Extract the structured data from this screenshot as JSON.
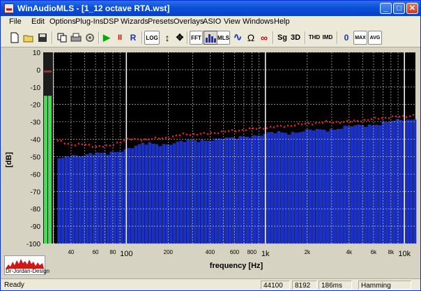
{
  "window": {
    "title": "WinAudioMLS - [1_12 octave RTA.wst]",
    "minimize_glyph": "_",
    "maximize_glyph": "□",
    "close_glyph": "✕"
  },
  "menu": [
    "File",
    "Edit",
    "Options",
    "Plug-Ins",
    "DSP",
    "Wizards",
    "Presets",
    "Overlays",
    "ASIO",
    "View",
    "Windows",
    "Help"
  ],
  "toolbar": {
    "buttons": [
      {
        "name": "new-file-icon",
        "label": ""
      },
      {
        "name": "open-folder-icon",
        "label": ""
      },
      {
        "name": "save-disk-icon",
        "label": ""
      },
      {
        "name": "copy-icon",
        "label": ""
      },
      {
        "name": "print-icon",
        "label": ""
      },
      {
        "name": "plugin-icon",
        "label": ""
      },
      {
        "name": "play-icon",
        "label": "▶"
      },
      {
        "name": "pause-icon",
        "label": "II"
      },
      {
        "name": "record-button",
        "label": "R"
      },
      {
        "name": "log-scale-button",
        "label": "LOG"
      },
      {
        "name": "vertical-zoom-icon",
        "label": "↕"
      },
      {
        "name": "pan-cross-icon",
        "label": "✥"
      },
      {
        "name": "fft-button",
        "label": "FFT"
      },
      {
        "name": "bar-graph-icon",
        "label": ""
      },
      {
        "name": "mls-button",
        "label": "MLS"
      },
      {
        "name": "waveform-icon",
        "label": "∿"
      },
      {
        "name": "impedance-omega-icon",
        "label": "Ω"
      },
      {
        "name": "loop-signal-icon",
        "label": "∞"
      },
      {
        "name": "sg-button",
        "label": "Sg"
      },
      {
        "name": "3d-button",
        "label": "3D"
      },
      {
        "name": "thd-button",
        "label": "THD"
      },
      {
        "name": "imd-button",
        "label": "IMD"
      },
      {
        "name": "zero-button",
        "label": "0"
      },
      {
        "name": "max-button",
        "label": "MAX"
      },
      {
        "name": "avg-button",
        "label": "AVG"
      }
    ]
  },
  "chart_data": {
    "type": "bar",
    "xlabel": "frequency [Hz]",
    "ylabel": "[dB]",
    "x_scale": "log",
    "xlim": [
      30,
      12000
    ],
    "ylim": [
      -100,
      10
    ],
    "y_ticks": [
      10,
      0,
      -10,
      -20,
      -30,
      -40,
      -50,
      -60,
      -70,
      -80,
      -90,
      -100
    ],
    "x_ticks": [
      {
        "value": 40,
        "label": "40",
        "major": false
      },
      {
        "value": 60,
        "label": "60",
        "major": false
      },
      {
        "value": 80,
        "label": "80",
        "major": false
      },
      {
        "value": 100,
        "label": "100",
        "major": true
      },
      {
        "value": 200,
        "label": "200",
        "major": false
      },
      {
        "value": 400,
        "label": "400",
        "major": false
      },
      {
        "value": 600,
        "label": "600",
        "major": false
      },
      {
        "value": 800,
        "label": "800",
        "major": false
      },
      {
        "value": 1000,
        "label": "1k",
        "major": true
      },
      {
        "value": 2000,
        "label": "2k",
        "major": false
      },
      {
        "value": 4000,
        "label": "4k",
        "major": false
      },
      {
        "value": 6000,
        "label": "6k",
        "major": false
      },
      {
        "value": 8000,
        "label": "8k",
        "major": false
      },
      {
        "value": 10000,
        "label": "10k",
        "major": true
      }
    ],
    "grid": true,
    "bar_anchors": [
      [
        33,
        -52
      ],
      [
        38,
        -50
      ],
      [
        45,
        -49
      ],
      [
        55,
        -48
      ],
      [
        70,
        -49
      ],
      [
        85,
        -47
      ],
      [
        100,
        -45
      ],
      [
        130,
        -43
      ],
      [
        170,
        -43
      ],
      [
        220,
        -42
      ],
      [
        300,
        -41
      ],
      [
        400,
        -40
      ],
      [
        550,
        -40
      ],
      [
        700,
        -38
      ],
      [
        900,
        -38
      ],
      [
        1200,
        -36
      ],
      [
        1600,
        -36
      ],
      [
        2200,
        -35
      ],
      [
        3000,
        -34
      ],
      [
        4000,
        -33
      ],
      [
        5000,
        -32
      ],
      [
        6500,
        -31
      ],
      [
        8000,
        -30
      ],
      [
        10000,
        -29
      ],
      [
        11500,
        -28
      ]
    ],
    "peak_anchors": [
      [
        33,
        -41
      ],
      [
        40,
        -43
      ],
      [
        50,
        -43
      ],
      [
        60,
        -44
      ],
      [
        75,
        -44
      ],
      [
        85,
        -42
      ],
      [
        100,
        -40
      ],
      [
        140,
        -40
      ],
      [
        200,
        -39
      ],
      [
        260,
        -37
      ],
      [
        350,
        -37
      ],
      [
        450,
        -36
      ],
      [
        600,
        -35
      ],
      [
        800,
        -34
      ],
      [
        1100,
        -33
      ],
      [
        1500,
        -32
      ],
      [
        2000,
        -31
      ],
      [
        2800,
        -30
      ],
      [
        3800,
        -30
      ],
      [
        5000,
        -29
      ],
      [
        6500,
        -28
      ],
      [
        8000,
        -27
      ],
      [
        10000,
        -27
      ],
      [
        11500,
        -26
      ]
    ],
    "peak_color": "#dd2222",
    "bar_color": "#1a2fc4",
    "plot_background": "#000000",
    "level_meter": {
      "left_db": -100,
      "right_db": -15,
      "peak_db": 0,
      "color": "#39e54b"
    }
  },
  "logo": {
    "text": "Dr-Jordan-Design"
  },
  "status": {
    "ready": "Ready",
    "sample_rate": "44100",
    "fft_size": "8192",
    "duration": "186ms",
    "window": "Hamming"
  }
}
